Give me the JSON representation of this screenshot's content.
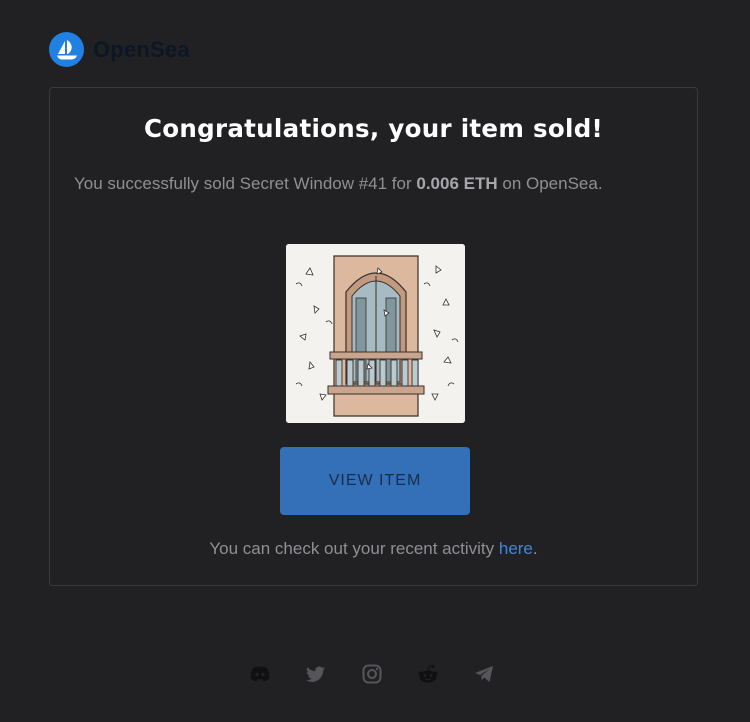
{
  "brand": {
    "name": "OpenSea",
    "logo_icon": "opensea-ship-icon",
    "accent_color": "#2081e2"
  },
  "email": {
    "headline": "Congratulations, your item sold!",
    "summary": {
      "prefix": "You successfully sold Secret Window #41 for ",
      "price": "0.006 ETH",
      "suffix": " on OpenSea."
    },
    "nft_image": {
      "icon": "balcony-window-artwork"
    },
    "cta_button": {
      "label": "VIEW ITEM",
      "color": "#3370b8"
    },
    "activity_note": {
      "prefix": "You can check out your recent activity ",
      "link_label": "here",
      "suffix": "."
    }
  },
  "footer": {
    "social_icons": [
      "discord-icon",
      "twitter-icon",
      "instagram-icon",
      "reddit-icon",
      "telegram-icon"
    ]
  }
}
